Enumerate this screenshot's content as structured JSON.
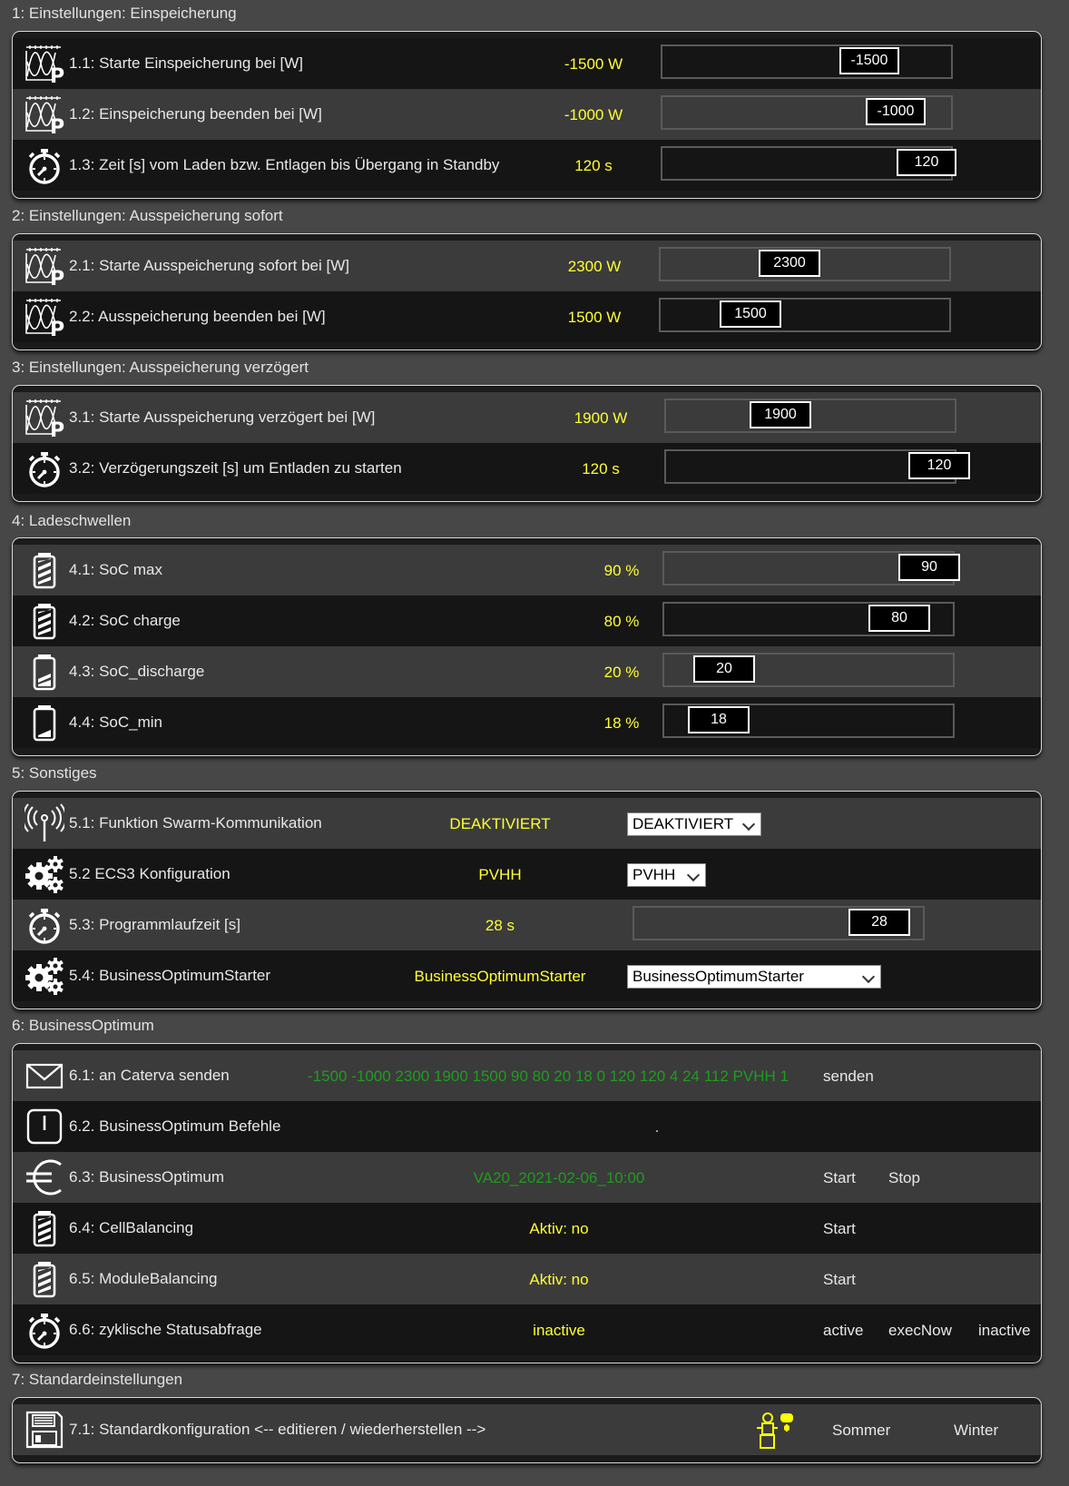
{
  "sections": [
    {
      "title": "1: Einstellungen: Einspeicherung"
    },
    {
      "title": "2: Einstellungen: Ausspeicherung sofort"
    },
    {
      "title": "3: Einstellungen: Ausspeicherung verzögert"
    },
    {
      "title": "4: Ladeschwellen"
    },
    {
      "title": "5: Sonstiges"
    },
    {
      "title": "6: BusinessOptimum"
    },
    {
      "title": "7: Standardeinstellungen"
    }
  ],
  "s1": {
    "r1": {
      "label": "1.1: Starte Einspeicherung bei [W]",
      "value": "-1500 W",
      "input": "-1500"
    },
    "r2": {
      "label": "1.2: Einspeicherung beenden bei [W]",
      "value": "-1000 W",
      "input": "-1000"
    },
    "r3": {
      "label": "1.3: Zeit [s] vom Laden bzw. Entlagen bis Übergang in Standby",
      "value": "120 s",
      "input": "120"
    }
  },
  "s2": {
    "r1": {
      "label": "2.1: Starte Ausspeicherung sofort bei [W]",
      "value": "2300 W",
      "input": "2300"
    },
    "r2": {
      "label": "2.2: Ausspeicherung beenden bei [W]",
      "value": "1500 W",
      "input": "1500"
    }
  },
  "s3": {
    "r1": {
      "label": "3.1: Starte Ausspeicherung verzögert bei [W]",
      "value": "1900 W",
      "input": "1900"
    },
    "r2": {
      "label": "3.2: Verzögerungszeit [s] um Entladen zu starten",
      "value": "120 s",
      "input": "120"
    }
  },
  "s4": {
    "r1": {
      "label": "4.1: SoC max",
      "value": "90 %",
      "input": "90"
    },
    "r2": {
      "label": "4.2: SoC charge",
      "value": "80 %",
      "input": "80"
    },
    "r3": {
      "label": "4.3: SoC_discharge",
      "value": "20 %",
      "input": "20"
    },
    "r4": {
      "label": "4.4: SoC_min",
      "value": "18 %",
      "input": "18"
    }
  },
  "s5": {
    "r1": {
      "label": "5.1: Funktion Swarm-Kommunikation",
      "value": "DEAKTIVIERT",
      "select": "DEAKTIVIERT"
    },
    "r2": {
      "label": "5.2 ECS3 Konfiguration",
      "value": "PVHH",
      "select": "PVHH"
    },
    "r3": {
      "label": "5.3: Programmlaufzeit [s]",
      "value": "28 s",
      "input": "28"
    },
    "r4": {
      "label": "5.4: BusinessOptimumStarter",
      "value": "BusinessOptimumStarter",
      "select": "BusinessOptimumStarter"
    }
  },
  "s6": {
    "r1": {
      "label": "6.1: an Caterva senden",
      "value": "-1500 -1000 2300 1900 1500 90 80 20 18 0 120 120 4 24 112 PVHH 1",
      "btn1": "senden"
    },
    "r2": {
      "label": "6.2. BusinessOptimum Befehle",
      "value": "."
    },
    "r3": {
      "label": "6.3: BusinessOptimum",
      "value": "VA20_2021-02-06_10:00",
      "btn1": "Start",
      "btn2": "Stop"
    },
    "r4": {
      "label": "6.4: CellBalancing",
      "value": "Aktiv: no",
      "btn1": "Start"
    },
    "r5": {
      "label": "6.5: ModuleBalancing",
      "value": "Aktiv: no",
      "btn1": "Start"
    },
    "r6": {
      "label": "6.6: zyklische Statusabfrage",
      "value": "inactive",
      "btn1": "active",
      "btn2": "execNow",
      "btn3": "inactive"
    }
  },
  "s7": {
    "r1": {
      "label": "7.1: Standardkonfiguration <-- editieren / wiederherstellen -->",
      "btn1": "Sommer",
      "btn2": "Winter"
    }
  },
  "colors": {
    "value": "#ffff33",
    "green": "#1f9c1f",
    "panel": "#1b1b1b",
    "row_light": "#3b3b3b"
  },
  "icons": [
    "power-chart-icon",
    "stopwatch-icon",
    "battery-icon",
    "antenna-icon",
    "gears-icon",
    "envelope-icon",
    "power-icon",
    "euro-icon",
    "floppy-icon",
    "summer-winter-icon"
  ]
}
